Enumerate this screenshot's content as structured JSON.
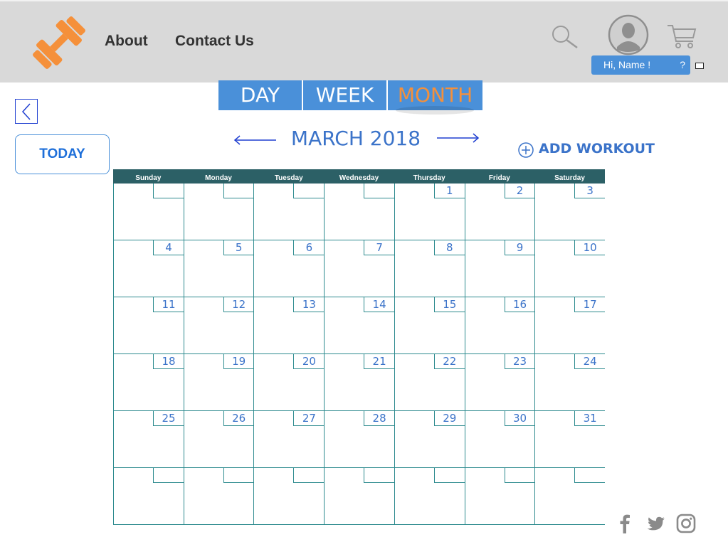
{
  "header": {
    "nav": {
      "about": "About",
      "contact": "Contact Us"
    },
    "user": {
      "greeting": "Hi, Name !",
      "help": "?"
    }
  },
  "icons": {
    "logo": "dumbbell-logo",
    "search": "search-icon",
    "avatar": "user-avatar",
    "cart": "cart-icon",
    "back": "chevron-left-icon",
    "add": "plus-circle-icon",
    "social": [
      "facebook-icon",
      "twitter-icon",
      "instagram-icon"
    ]
  },
  "sidebar": {
    "today_label": "TODAY"
  },
  "view_tabs": {
    "day": "DAY",
    "week": "WEEK",
    "month": "MONTH",
    "active": "month"
  },
  "calendar": {
    "title": "MARCH 2018",
    "add_workout_label": "ADD WORKOUT",
    "weekdays": [
      "Sunday",
      "Monday",
      "Tuesday",
      "Wednesday",
      "Thursday",
      "Friday",
      "Saturday"
    ],
    "weeks": [
      [
        "",
        "",
        "",
        "",
        "1",
        "2",
        "3"
      ],
      [
        "4",
        "5",
        "6",
        "7",
        "8",
        "9",
        "10"
      ],
      [
        "11",
        "12",
        "13",
        "14",
        "15",
        "16",
        "17"
      ],
      [
        "18",
        "19",
        "20",
        "21",
        "22",
        "23",
        "24"
      ],
      [
        "25",
        "26",
        "27",
        "28",
        "29",
        "30",
        "31"
      ],
      [
        "",
        "",
        "",
        "",
        "",
        "",
        ""
      ]
    ]
  },
  "colors": {
    "header_bg": "#d9d9d9",
    "accent_blue": "#4a90d9",
    "accent_orange": "#f5903a",
    "calendar_head": "#2c6066",
    "grid_line": "#2c8a8e",
    "date_text": "#3b73c9"
  }
}
